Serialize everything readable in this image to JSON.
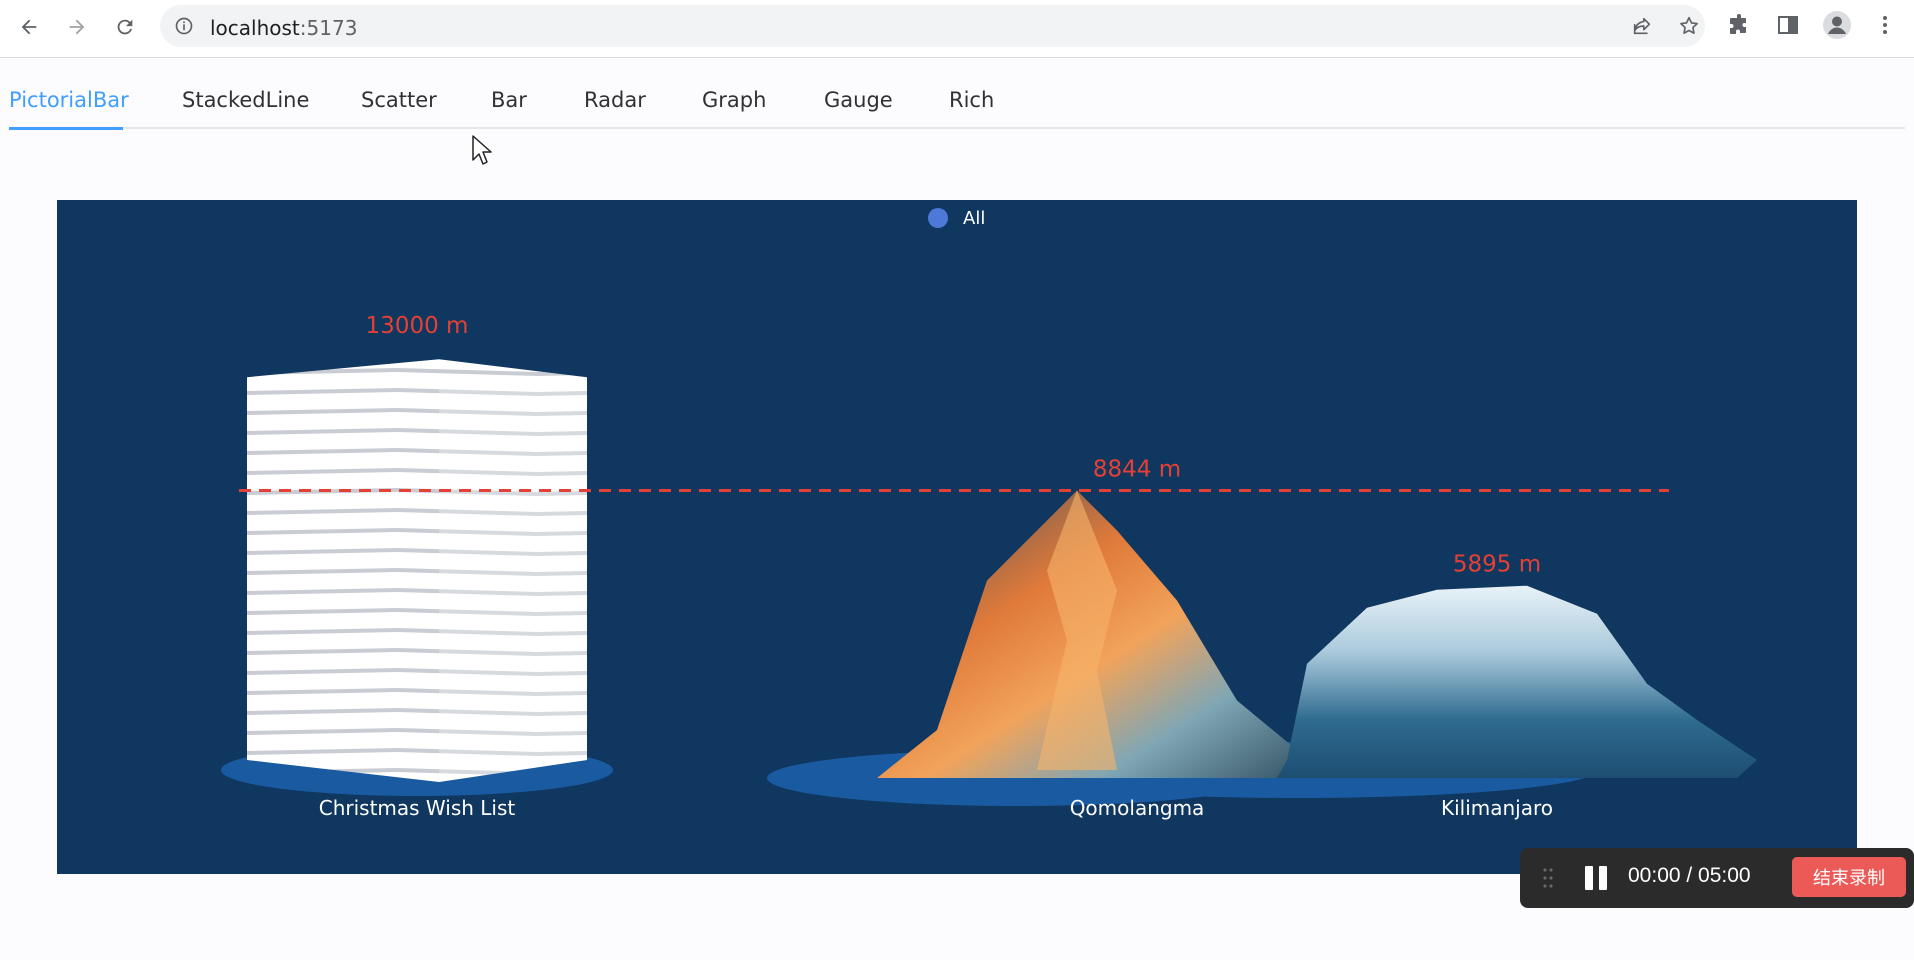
{
  "browser": {
    "url_host": "localhost",
    "url_port": ":5173"
  },
  "tabs": [
    {
      "label": "PictorialBar",
      "active": true
    },
    {
      "label": "StackedLine",
      "active": false
    },
    {
      "label": "Scatter",
      "active": false
    },
    {
      "label": "Bar",
      "active": false
    },
    {
      "label": "Radar",
      "active": false
    },
    {
      "label": "Graph",
      "active": false
    },
    {
      "label": "Gauge",
      "active": false
    },
    {
      "label": "Rich",
      "active": false
    }
  ],
  "chart_data": {
    "type": "bar",
    "legend": [
      "All"
    ],
    "legend_placement": "top-center",
    "categories": [
      "Christmas Wish List",
      "Qomolangma",
      "Kilimanjaro"
    ],
    "values": [
      13000,
      8844,
      5895
    ],
    "value_labels": [
      "13000 m",
      "8844 m",
      "5895 m"
    ],
    "markline": {
      "value": 8844,
      "style": "dashed"
    },
    "ylim": [
      0,
      15000
    ],
    "colors": {
      "background": "#0f375f",
      "label": "#e54035",
      "legend_dot": "#4e79d8",
      "base_ellipse": "#1a5aa0",
      "markline": "#e54035",
      "text": "#ffffff"
    }
  },
  "recorder": {
    "time": "00:00 / 05:00",
    "stop_label": "结束录制"
  }
}
